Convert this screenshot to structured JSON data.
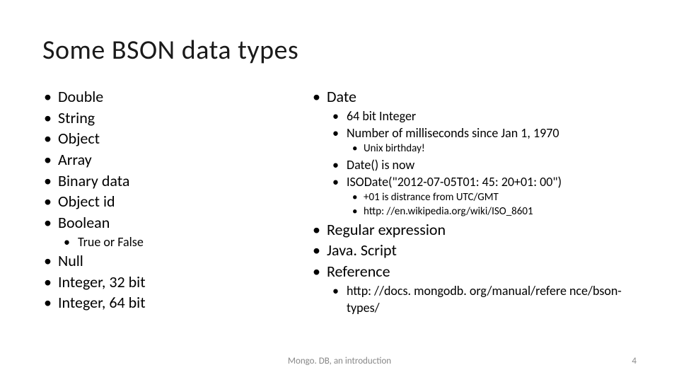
{
  "title": "Some BSON data types",
  "left": {
    "items": [
      "Double",
      "String",
      "Object",
      "Array",
      "Binary data",
      "Object id",
      "Boolean"
    ],
    "boolean_sub": "True or False",
    "items2": [
      "Null",
      "Integer, 32 bit",
      "Integer, 64 bit"
    ]
  },
  "right": {
    "date_label": "Date",
    "date_sub1": "64 bit Integer",
    "date_sub2": "Number of milliseconds since Jan 1, 1970",
    "date_sub2_sub": "Unix birthday!",
    "date_sub3": "Date() is now",
    "date_sub4": "ISODate(\"2012-07-05T01: 45: 20+01: 00\")",
    "date_sub4_sub1": "+01 is distrance from UTC/GMT",
    "date_sub4_sub2": "http: //en.wikipedia.org/wiki/ISO_8601",
    "regex": "Regular expression",
    "js": "Java. Script",
    "ref": "Reference",
    "ref_sub": "http: //docs. mongodb. org/manual/refere nce/bson-types/"
  },
  "footer": {
    "center": "Mongo. DB, an introduction",
    "page": "4"
  }
}
